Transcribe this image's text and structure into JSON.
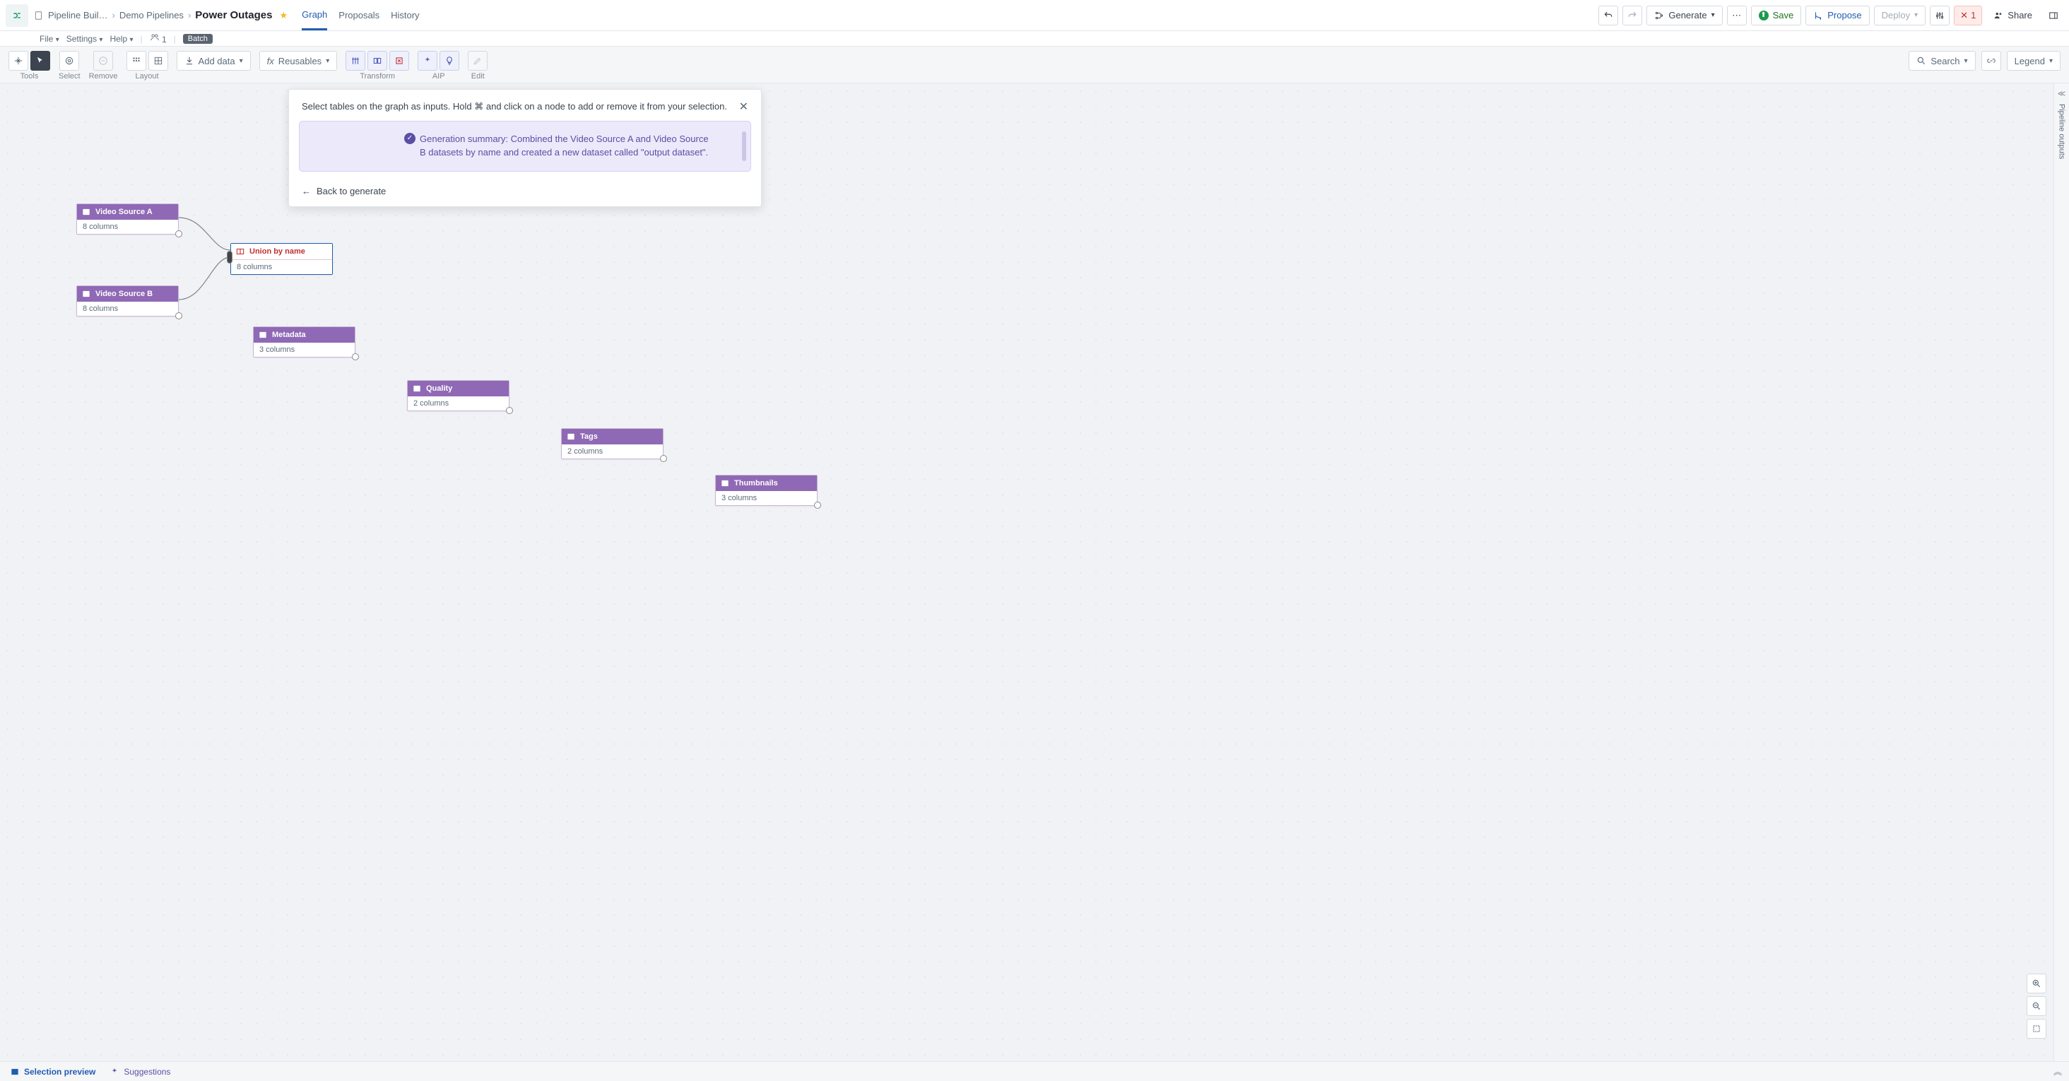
{
  "header": {
    "breadcrumb": [
      "Pipeline Buil…",
      "Demo Pipelines",
      "Power Outages"
    ],
    "tabs": {
      "graph": "Graph",
      "proposals": "Proposals",
      "history": "History"
    },
    "actions": {
      "generate": "Generate",
      "save": "Save",
      "propose": "Propose",
      "deploy": "Deploy",
      "share": "Share",
      "warn_count": "1"
    }
  },
  "subheader": {
    "file": "File",
    "settings": "Settings",
    "help": "Help",
    "users": "1",
    "batch": "Batch"
  },
  "toolbar": {
    "groups": {
      "tools": "Tools",
      "select": "Select",
      "remove": "Remove",
      "layout": "Layout",
      "transform": "Transform",
      "aip": "AIP",
      "edit": "Edit"
    },
    "add_data": "Add data",
    "reusables": "Reusables",
    "search": "Search",
    "legend": "Legend"
  },
  "panel": {
    "hint": "Select tables on the graph as inputs. Hold ⌘ and click on a node to add or remove it from your selection.",
    "summary": "Generation summary: Combined the Video Source A and Video Source B datasets by name and created a new dataset called \"output dataset\".",
    "back": "Back to generate"
  },
  "nodes": {
    "video_a": {
      "title": "Video Source A",
      "sub": "8 columns"
    },
    "video_b": {
      "title": "Video Source B",
      "sub": "8 columns"
    },
    "union": {
      "title": "Union by name",
      "sub": "8 columns"
    },
    "metadata": {
      "title": "Metadata",
      "sub": "3 columns"
    },
    "quality": {
      "title": "Quality",
      "sub": "2 columns"
    },
    "tags": {
      "title": "Tags",
      "sub": "2 columns"
    },
    "thumbnails": {
      "title": "Thumbnails",
      "sub": "3 columns"
    }
  },
  "rail": {
    "outputs": "Pipeline outputs"
  },
  "footer": {
    "selection_preview": "Selection preview",
    "suggestions": "Suggestions"
  }
}
